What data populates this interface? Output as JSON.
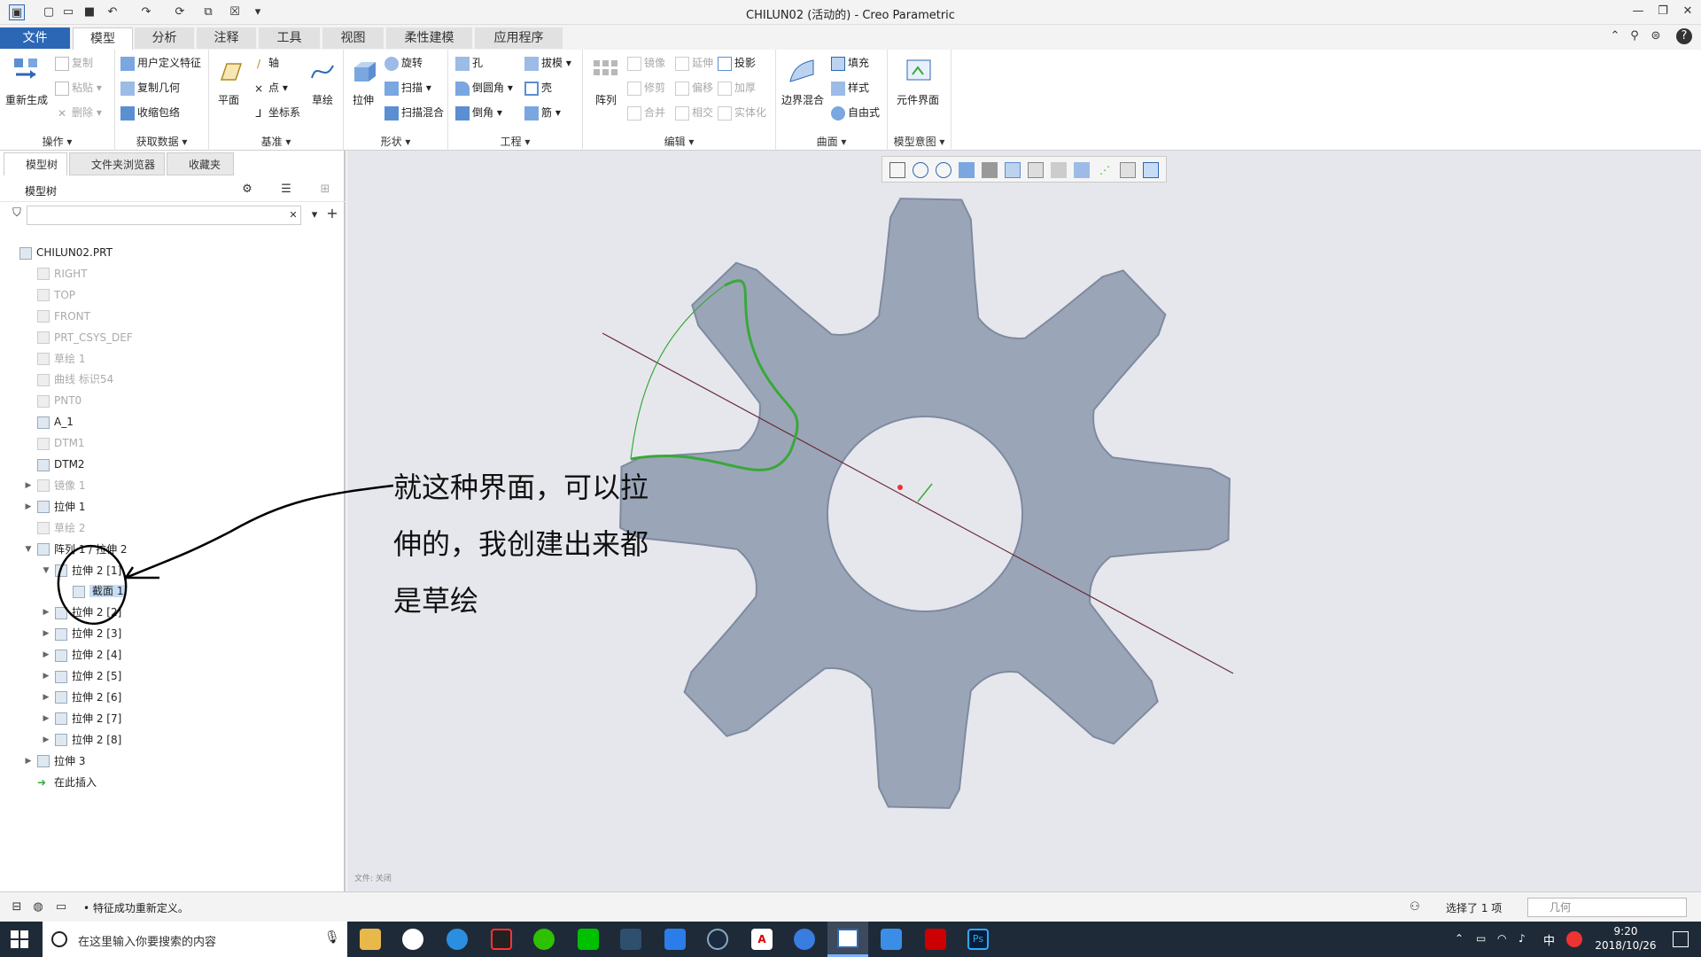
{
  "window": {
    "title": "CHILUN02 (活动的) - Creo Parametric"
  },
  "tabs": [
    {
      "label": "文件"
    },
    {
      "label": "模型"
    },
    {
      "label": "分析"
    },
    {
      "label": "注释"
    },
    {
      "label": "工具"
    },
    {
      "label": "视图"
    },
    {
      "label": "柔性建模"
    },
    {
      "label": "应用程序"
    }
  ],
  "ribbon": {
    "ops": {
      "label": "操作",
      "regen": "重新生成",
      "copy": "复制",
      "paste": "粘贴",
      "delete": "删除"
    },
    "getdata": {
      "label": "获取数据",
      "udf": "用户定义特征",
      "copygeom": "复制几何",
      "shrink": "收缩包络"
    },
    "datum": {
      "label": "基准",
      "plane": "平面",
      "axis": "轴",
      "point": "点",
      "csys": "坐标系",
      "sketch": "草绘"
    },
    "shapes": {
      "label": "形状",
      "extrude": "拉伸",
      "revolve": "旋转",
      "sweep": "扫描",
      "swpblend": "扫描混合"
    },
    "eng": {
      "label": "工程",
      "hole": "孔",
      "draft": "拔模",
      "round": "倒圆角",
      "shell": "壳",
      "chamfer": "倒角",
      "rib": "筋"
    },
    "edit": {
      "label": "编辑",
      "pattern": "阵列",
      "mirror": "镜像",
      "extend": "延伸",
      "project": "投影",
      "trim": "修剪",
      "offset": "偏移",
      "thicken": "加厚",
      "merge": "合并",
      "intersect": "相交",
      "solidify": "实体化"
    },
    "surf": {
      "label": "曲面",
      "boundary": "边界混合",
      "fill": "填充",
      "style": "样式",
      "freestyle": "自由式"
    },
    "intent": {
      "label": "模型意图",
      "component": "元件界面"
    }
  },
  "panel": {
    "tabs": [
      "模型树",
      "文件夹浏览器",
      "收藏夹"
    ],
    "tree_header": "模型树",
    "filter_placeholder": ""
  },
  "tree": [
    {
      "label": "CHILUN02.PRT",
      "dim": false,
      "level": 0
    },
    {
      "label": "RIGHT",
      "dim": true,
      "level": 1
    },
    {
      "label": "TOP",
      "dim": true,
      "level": 1
    },
    {
      "label": "FRONT",
      "dim": true,
      "level": 1
    },
    {
      "label": "PRT_CSYS_DEF",
      "dim": true,
      "level": 1
    },
    {
      "label": "草绘 1",
      "dim": true,
      "level": 1
    },
    {
      "label": "曲线 标识54",
      "dim": true,
      "level": 1
    },
    {
      "label": "PNT0",
      "dim": true,
      "level": 1
    },
    {
      "label": "A_1",
      "dim": false,
      "level": 1
    },
    {
      "label": "DTM1",
      "dim": true,
      "level": 1
    },
    {
      "label": "DTM2",
      "dim": false,
      "level": 1
    },
    {
      "label": "镜像 1",
      "dim": true,
      "level": 1,
      "exp": "▶"
    },
    {
      "label": "拉伸 1",
      "dim": false,
      "level": 1,
      "exp": "▶"
    },
    {
      "label": "草绘 2",
      "dim": true,
      "level": 1
    },
    {
      "label": "阵列 1 / 拉伸 2",
      "dim": false,
      "level": 1,
      "exp": "▼"
    },
    {
      "label": "拉伸 2 [1]",
      "dim": false,
      "level": 2,
      "exp": "▼"
    },
    {
      "label": "截面 1",
      "dim": false,
      "level": 3,
      "sel": true
    },
    {
      "label": "拉伸 2 [2]",
      "dim": false,
      "level": 2,
      "exp": "▶"
    },
    {
      "label": "拉伸 2 [3]",
      "dim": false,
      "level": 2,
      "exp": "▶"
    },
    {
      "label": "拉伸 2 [4]",
      "dim": false,
      "level": 2,
      "exp": "▶"
    },
    {
      "label": "拉伸 2 [5]",
      "dim": false,
      "level": 2,
      "exp": "▶"
    },
    {
      "label": "拉伸 2 [6]",
      "dim": false,
      "level": 2,
      "exp": "▶"
    },
    {
      "label": "拉伸 2 [7]",
      "dim": false,
      "level": 2,
      "exp": "▶"
    },
    {
      "label": "拉伸 2 [8]",
      "dim": false,
      "level": 2,
      "exp": "▶"
    },
    {
      "label": "拉伸 3",
      "dim": false,
      "level": 1,
      "exp": "▶"
    },
    {
      "label": "在此插入",
      "dim": false,
      "level": 1,
      "insert": true
    }
  ],
  "annotation": {
    "line1": "就这种界面，可以拉",
    "line2": "伸的，我创建出来都",
    "line3": "是草绘"
  },
  "viewport": {
    "small_label": "文件: 关闭"
  },
  "status": {
    "message": "• 特征成功重新定义。",
    "selected": "选择了 1 项",
    "filter": "几何"
  },
  "taskbar": {
    "search": "在这里输入你要搜索的内容",
    "time": "9:20",
    "date": "2018/10/26",
    "ime": "中"
  },
  "colors": {
    "gear": "#9aa6b8",
    "accent": "#2c67b5",
    "sketch": "#3aa83a"
  }
}
